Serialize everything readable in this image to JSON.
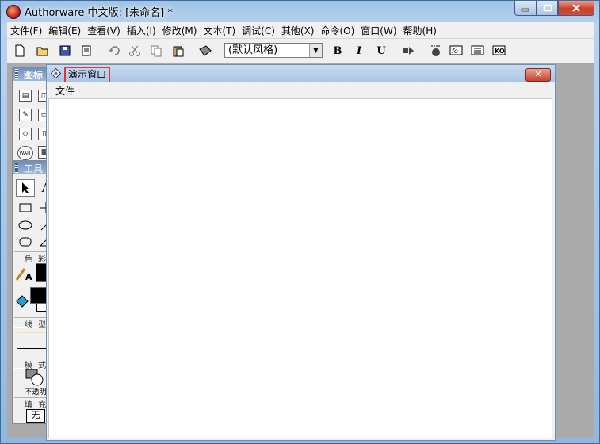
{
  "window": {
    "title": "Authorware 中文版: [未命名] *"
  },
  "menu": [
    "文件(F)",
    "编辑(E)",
    "查看(V)",
    "插入(I)",
    "修改(M)",
    "文本(T)",
    "调试(C)",
    "其他(X)",
    "命令(O)",
    "窗口(W)",
    "帮助(H)"
  ],
  "toolbar": {
    "style_value": "(默认风格)",
    "bold": "B",
    "italic": "I",
    "underline": "U",
    "icons": [
      "new-icon",
      "open-icon",
      "save-all-icon",
      "import-icon",
      "undo-icon",
      "cut-icon",
      "copy-icon",
      "paste-icon",
      "find-icon",
      "run-icon",
      "control-panel-icon",
      "functions-icon",
      "variables-icon",
      "knowledge-objects-icon"
    ]
  },
  "icon_palette": {
    "title": "图标"
  },
  "tools_palette": {
    "title": "工具",
    "sections": {
      "color": "色 彩",
      "line": "线 型",
      "mode": "模 式",
      "fill": "填 充"
    },
    "mode_value": "不透明",
    "fill_value": "无"
  },
  "presentation": {
    "title": "演示窗口",
    "menu": [
      "文件"
    ],
    "highlight_color": "#e0363a"
  }
}
